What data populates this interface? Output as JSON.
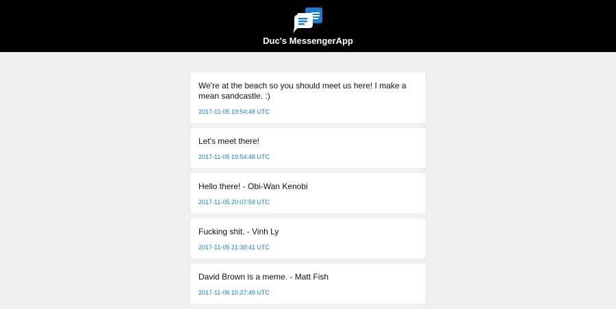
{
  "header": {
    "logo_icon": "chat-bubbles-icon",
    "title": "Duc's MessengerApp"
  },
  "colors": {
    "header_bg": "#000000",
    "page_bg": "#efefef",
    "accent": "#1a7bd0"
  },
  "messages": [
    {
      "text": "We're at the beach so you should meet us here! I make a mean sandcastle. :)",
      "timestamp": "2017-11-05 19:54:48 UTC"
    },
    {
      "text": "Let's meet there!",
      "timestamp": "2017-11-05 19:54:48 UTC"
    },
    {
      "text": "Hello there! - Obi-Wan Kenobi",
      "timestamp": "2017-11-05 20:07:59 UTC"
    },
    {
      "text": "Fucking shit. - Vinh Ly",
      "timestamp": "2017-11-05 21:30:41 UTC"
    },
    {
      "text": "David Brown is a meme. - Matt Fish",
      "timestamp": "2017-11-06 15:27:49 UTC"
    }
  ]
}
